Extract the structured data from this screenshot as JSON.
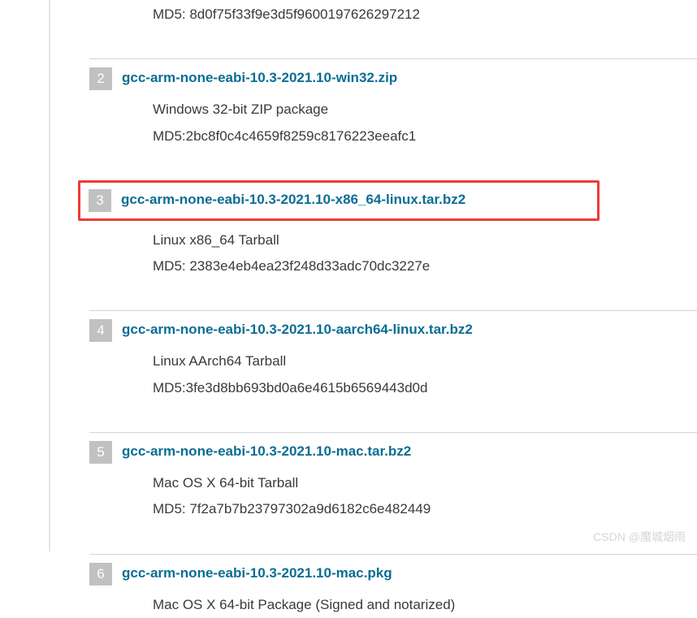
{
  "first_item": {
    "md5": "MD5: 8d0f75f33f9e3d5f9600197626297212"
  },
  "items": [
    {
      "number": "2",
      "link": "gcc-arm-none-eabi-10.3-2021.10-win32.zip",
      "description": "Windows 32-bit ZIP package",
      "md5": "MD5:2bc8f0c4c4659f8259c8176223eeafc1",
      "highlighted": false
    },
    {
      "number": "3",
      "link": "gcc-arm-none-eabi-10.3-2021.10-x86_64-linux.tar.bz2",
      "description": "Linux x86_64 Tarball",
      "md5": "MD5: 2383e4eb4ea23f248d33adc70dc3227e",
      "highlighted": true
    },
    {
      "number": "4",
      "link": "gcc-arm-none-eabi-10.3-2021.10-aarch64-linux.tar.bz2",
      "description": "Linux AArch64 Tarball",
      "md5": "MD5:3fe3d8bb693bd0a6e4615b6569443d0d",
      "highlighted": false
    },
    {
      "number": "5",
      "link": "gcc-arm-none-eabi-10.3-2021.10-mac.tar.bz2",
      "description": "Mac OS X 64-bit Tarball",
      "md5": "MD5: 7f2a7b7b23797302a9d6182c6e482449",
      "highlighted": false
    },
    {
      "number": "6",
      "link": "gcc-arm-none-eabi-10.3-2021.10-mac.pkg",
      "description": "Mac OS X 64-bit Package (Signed and notarized)",
      "md5": "",
      "highlighted": false
    }
  ],
  "watermark": "CSDN @魔城烟雨"
}
